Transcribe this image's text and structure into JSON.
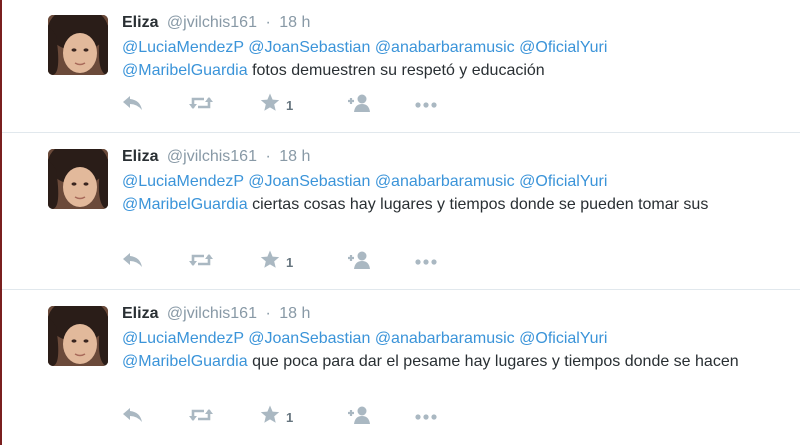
{
  "tweets": [
    {
      "name": "Eliza",
      "handle": "@jvilchis161",
      "separator": "·",
      "time": "18 h",
      "mentions": [
        "@LuciaMendezP",
        "@JoanSebastian",
        "@anabarbaramusic",
        "@OficialYuri",
        "@MaribelGuardia"
      ],
      "text": "fotos demuestren su respetó y educación",
      "favorites": "1"
    },
    {
      "name": "Eliza",
      "handle": "@jvilchis161",
      "separator": "·",
      "time": "18 h",
      "mentions": [
        "@LuciaMendezP",
        "@JoanSebastian",
        "@anabarbaramusic",
        "@OficialYuri",
        "@MaribelGuardia"
      ],
      "text": "ciertas cosas hay lugares y tiempos donde se pueden tomar sus",
      "favorites": "1"
    },
    {
      "name": "Eliza",
      "handle": "@jvilchis161",
      "separator": "·",
      "time": "18 h",
      "mentions": [
        "@LuciaMendezP",
        "@JoanSebastian",
        "@anabarbaramusic",
        "@OficialYuri",
        "@MaribelGuardia"
      ],
      "text": "que poca para dar el pesame hay lugares y tiempos donde se hacen",
      "favorites": "1"
    }
  ],
  "icons": {
    "reply": "reply-icon",
    "retweet": "retweet-icon",
    "favorite": "star-icon",
    "follow": "follow-icon",
    "more": "more-icon"
  },
  "colors": {
    "mention": "#3b94d9",
    "name": "#292f33",
    "meta": "#8899a6",
    "icon": "#aab8c2",
    "divider": "#e1e8ed"
  }
}
